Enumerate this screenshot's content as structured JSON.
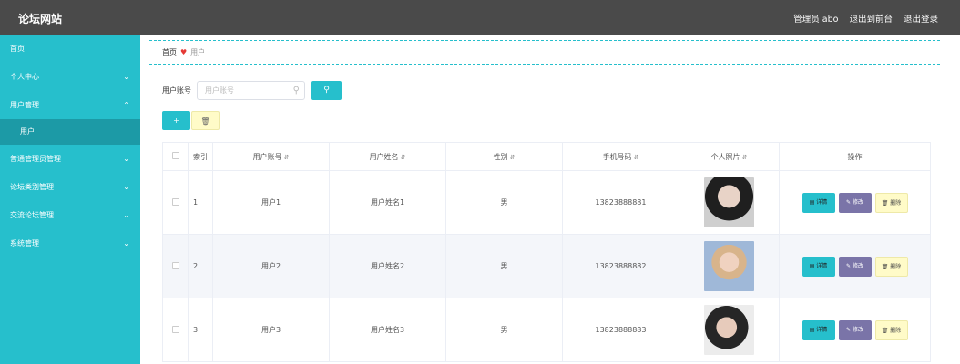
{
  "header": {
    "title": "论坛网站",
    "user_label": "管理员 abo",
    "back_label": "退出到前台",
    "logout_label": "退出登录"
  },
  "sidebar": {
    "items": [
      {
        "label": "首页"
      },
      {
        "label": "个人中心"
      },
      {
        "label": "用户管理"
      },
      {
        "label": "用户"
      },
      {
        "label": "普通管理员管理"
      },
      {
        "label": "论坛类别管理"
      },
      {
        "label": "交流论坛管理"
      },
      {
        "label": "系统管理"
      }
    ]
  },
  "breadcrumb": {
    "home": "首页",
    "current": "用户"
  },
  "search": {
    "label": "用户账号",
    "placeholder": "用户账号"
  },
  "table": {
    "headers": [
      "索引",
      "用户账号",
      "用户姓名",
      "性别",
      "手机号码",
      "个人照片",
      "操作"
    ],
    "rows": [
      {
        "index": "1",
        "account": "用户1",
        "name": "用户姓名1",
        "gender": "男",
        "phone": "13823888881"
      },
      {
        "index": "2",
        "account": "用户2",
        "name": "用户姓名2",
        "gender": "男",
        "phone": "13823888882"
      },
      {
        "index": "3",
        "account": "用户3",
        "name": "用户姓名3",
        "gender": "男",
        "phone": "13823888883"
      }
    ],
    "op_labels": {
      "detail": "详情",
      "edit": "修改",
      "remove": "删除"
    }
  },
  "colors": {
    "accent": "#26bfcc",
    "topbar": "#4a4a4a",
    "edit": "#7a74a8",
    "warn": "#fffbc8"
  }
}
